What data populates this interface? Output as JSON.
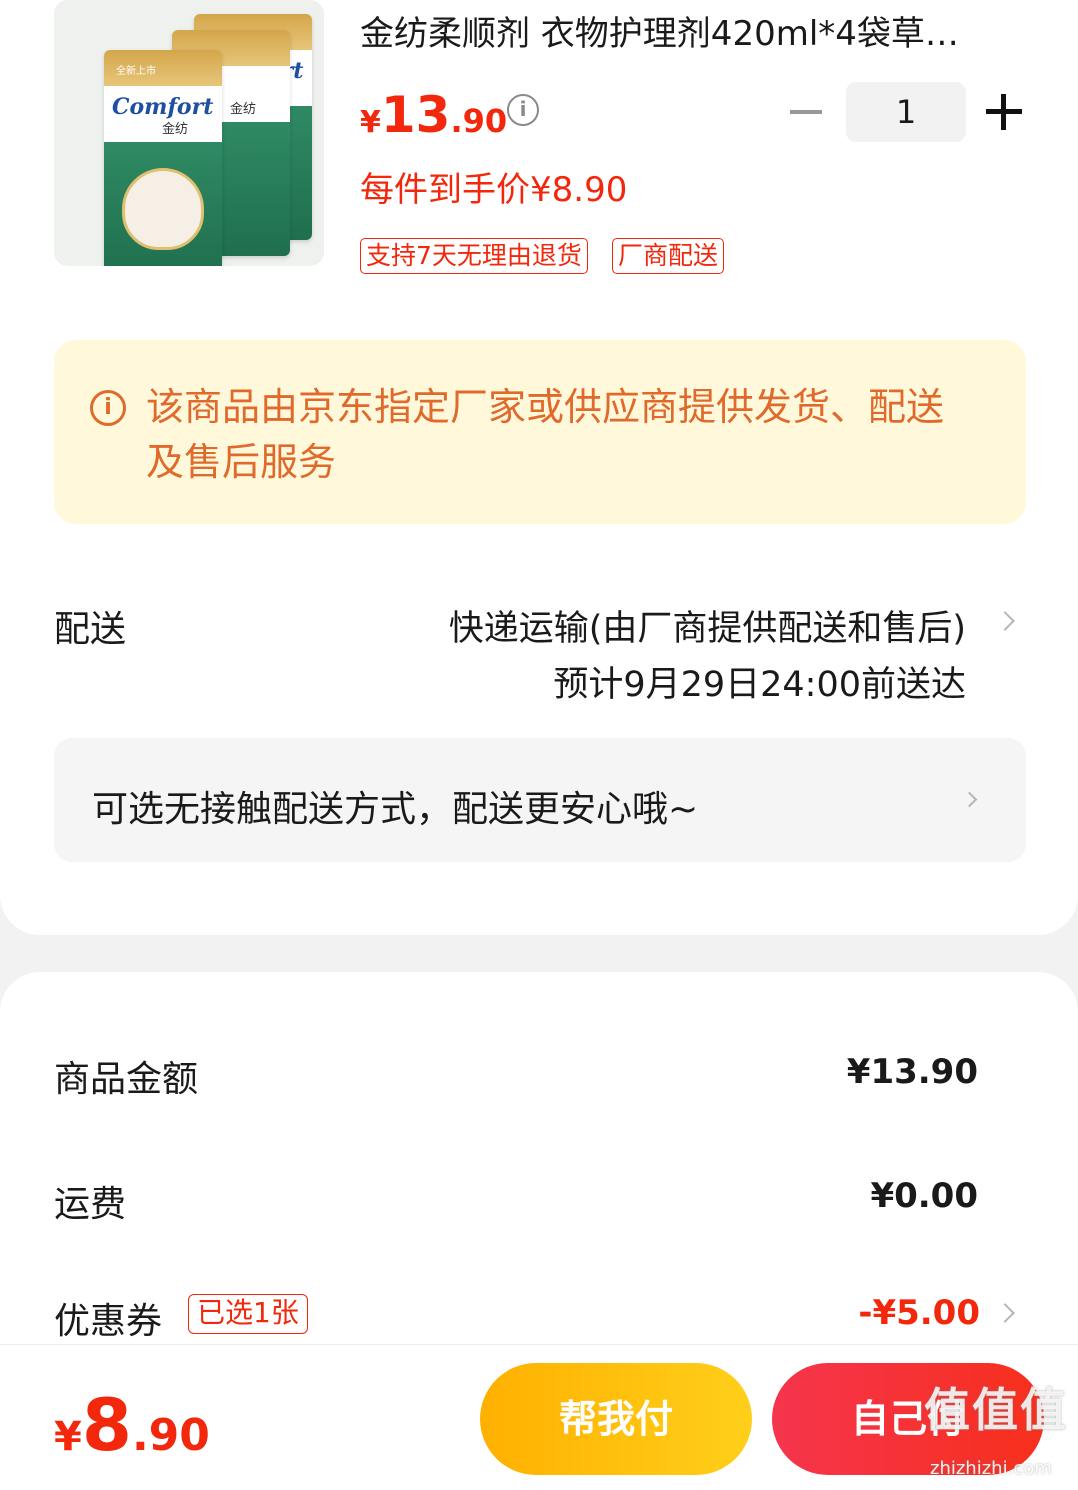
{
  "product": {
    "title": "金纺柔顺剂 衣物护理剂420ml*4袋草…",
    "image_logo": "Comfort",
    "image_cn": "金纺",
    "image_tagline": "全新上市",
    "price_currency": "¥",
    "price_int": "13",
    "price_dec": ".90",
    "info_icon": "info-icon",
    "unit_price": "每件到手价¥8.90",
    "quantity": "1",
    "tags": [
      "支持7天无理由退货",
      "厂商配送"
    ]
  },
  "notice": {
    "icon": "info-icon",
    "text": "该商品由京东指定厂家或供应商提供发货、配送及售后服务"
  },
  "delivery": {
    "label": "配送",
    "method": "快递运输(由厂商提供配送和售后)",
    "eta": "预计9月29日24:00前送达",
    "contactless": "可选无接触配送方式，配送更安心哦~"
  },
  "costs": {
    "goods_label": "商品金额",
    "goods_value": "¥13.90",
    "shipping_label": "运费",
    "shipping_value": "¥0.00",
    "coupon_label": "优惠券",
    "coupon_tag": "已选1张",
    "coupon_value": "-¥5.00"
  },
  "footer": {
    "total_currency": "¥",
    "total_int": "8",
    "total_dec": ".90",
    "help_pay": "帮我付",
    "self_pay": "自己付",
    "watermark": "值值值",
    "watermark_url": "zhizhizhi.com"
  },
  "colors": {
    "accent_red": "#f2270c",
    "notice_bg": "#fff8db",
    "notice_text": "#e06a2b",
    "help_btn": "#ffb000",
    "self_btn": "#f5354e"
  }
}
